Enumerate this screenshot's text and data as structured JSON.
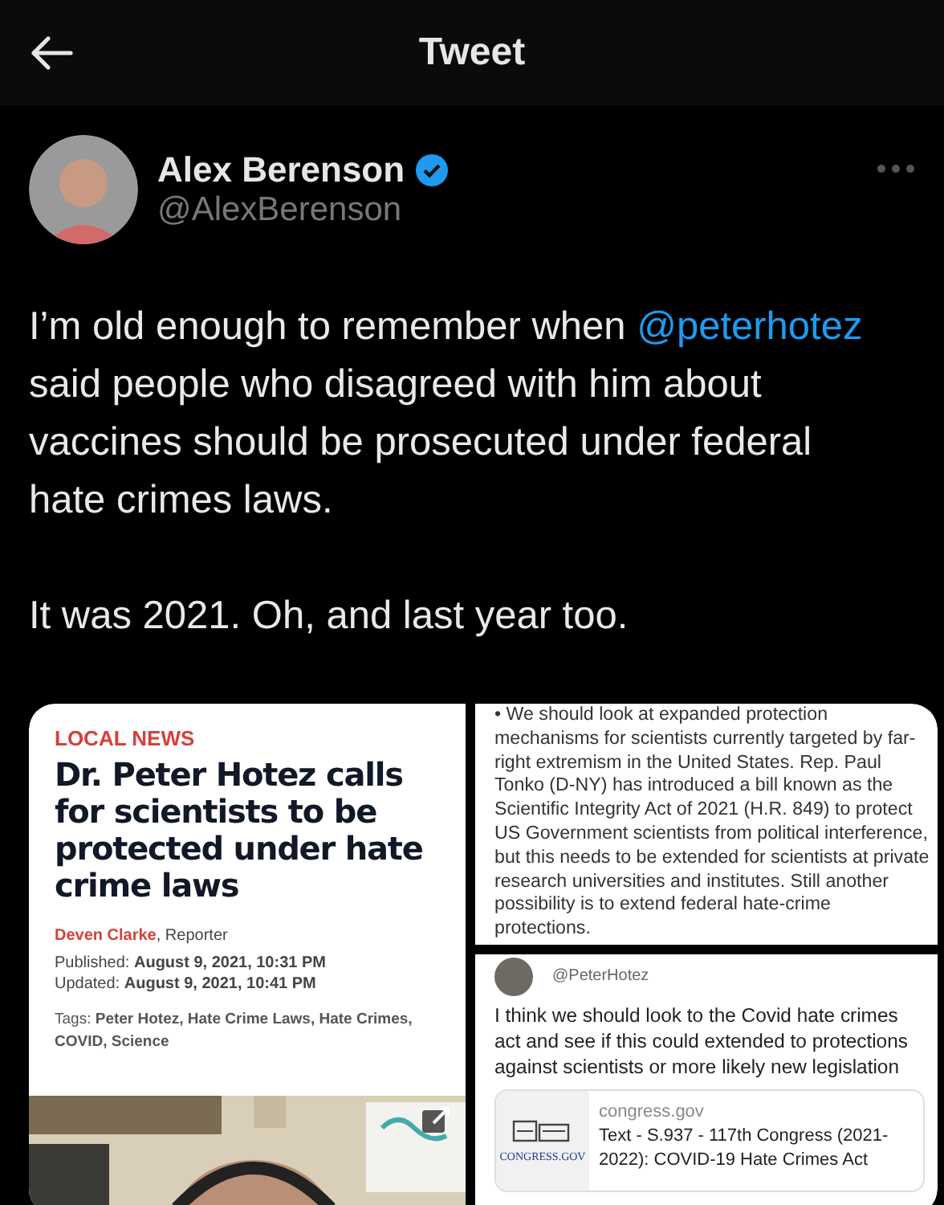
{
  "header": {
    "title": "Tweet"
  },
  "author": {
    "name": "Alex Berenson",
    "verified": true,
    "handle": "@AlexBerenson"
  },
  "tweet": {
    "before": "I’m old enough to remember when ",
    "mention": "@peterhotez",
    "after": " said people who disagreed with him about vaccines should be prosecuted under federal hate crimes laws.",
    "second": "It was 2021. Oh, and last year too."
  },
  "article": {
    "section": "LOCAL NEWS",
    "headline": "Dr. Peter Hotez calls for scientists to be protected under hate crime laws",
    "author": "Deven Clarke",
    "role": ", Reporter",
    "published": "Published: **August 9, 2021, 10:31 PM**",
    "updated": "Updated: **August 9, 2021, 10:41 PM**",
    "tags": "Tags: **Peter Hotez, Hate Crime Laws, Hate Crimes, COVID, Science**"
  },
  "excerpt": {
    "text": "• We should look at expanded protection mechanisms for scientists currently targeted by far-right extremism in the United States. Rep. Paul Tonko (D-NY) has introduced a bill known as the Scientific Integrity Act of 2021 (H.R. 849) to protect US Government scientists from political interference, but this needs to be extended for scientists at private research universities and institutes. Still another possibility is to extend federal hate-crime protections."
  },
  "quoted": {
    "handle": "@PeterHotez",
    "text": "I think we should look to the Covid hate crimes act and see if this could extended to protections against scientists or more likely new legislation",
    "card": {
      "logo": "CONGRESS.GOV",
      "domain": "congress.gov",
      "title": "Text - S.937 - 117th Congress (2021-2022): COVID-19 Hate Crimes Act"
    }
  }
}
